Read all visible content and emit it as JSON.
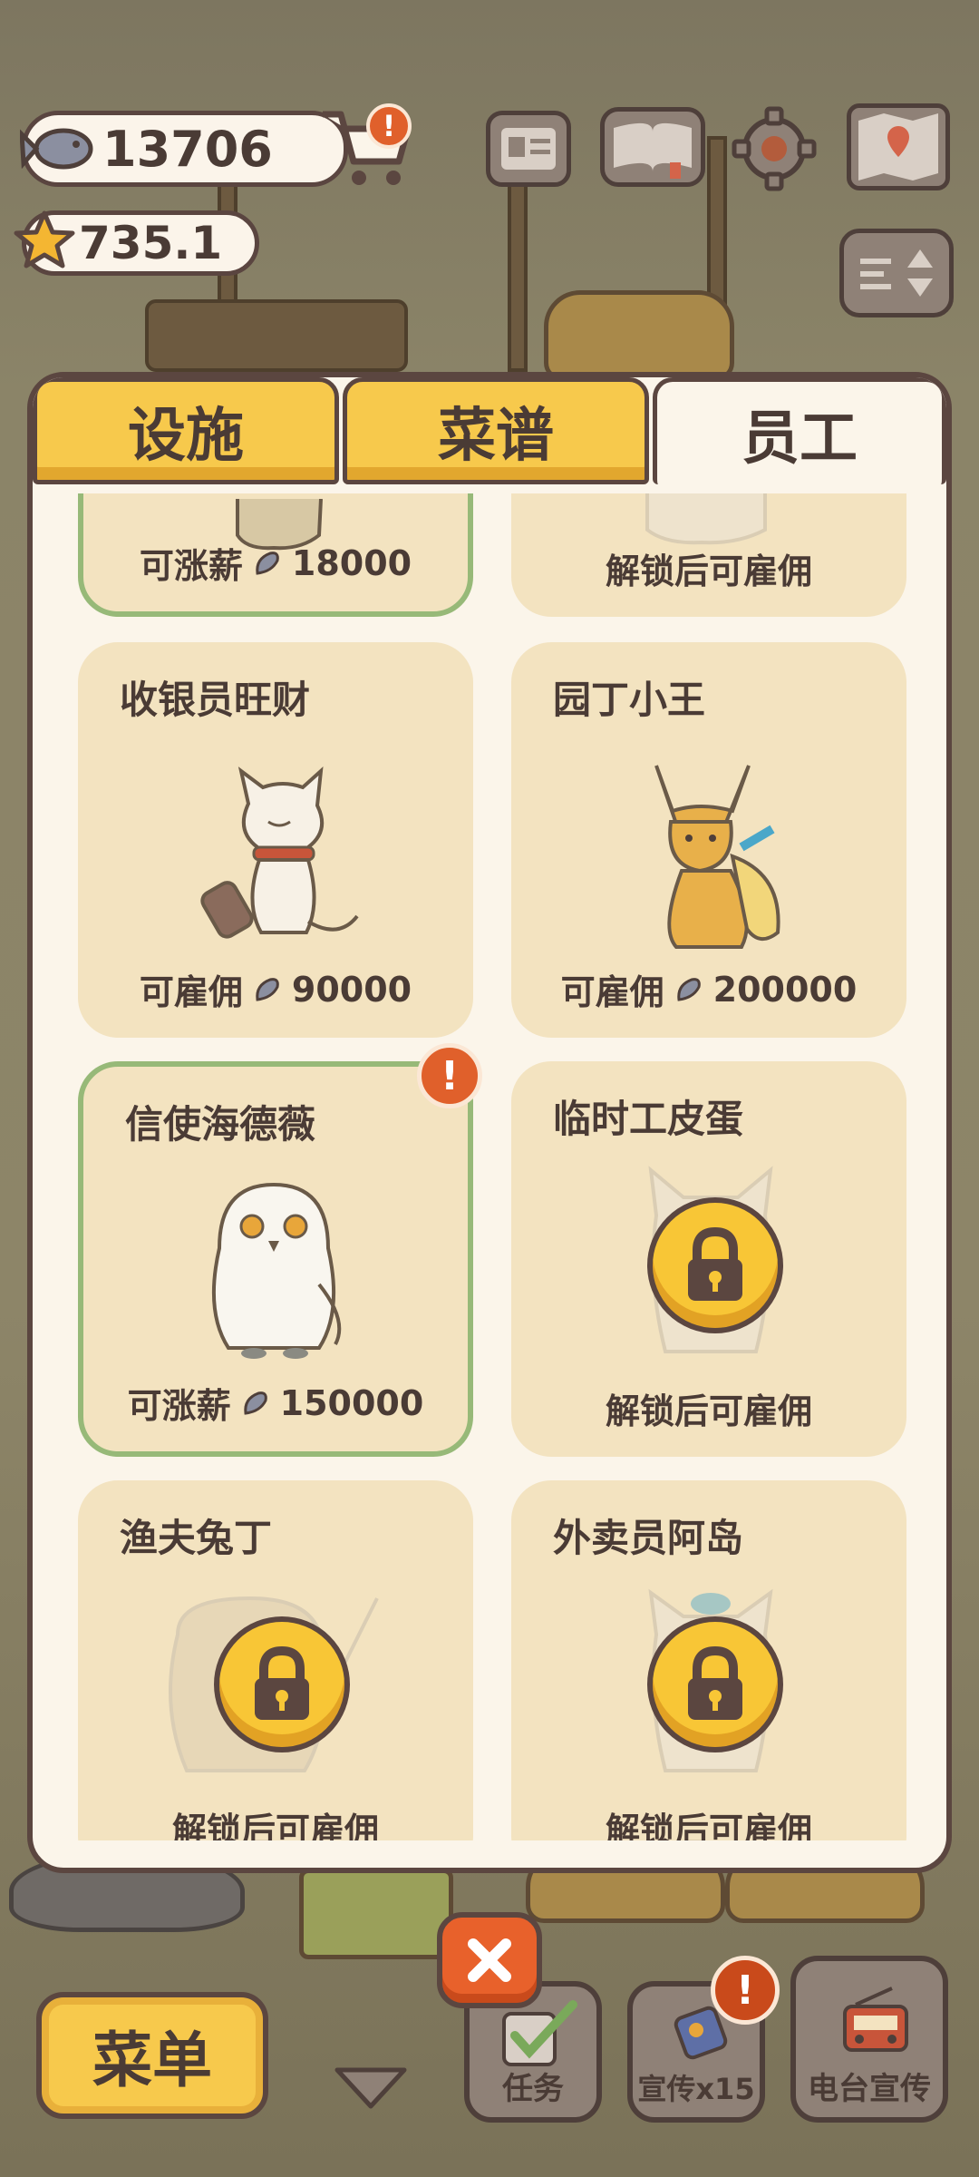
{
  "hud": {
    "fish_count": "13706",
    "star_count": "735.1"
  },
  "tabs": [
    {
      "label": "设施",
      "active": false
    },
    {
      "label": "菜谱",
      "active": false
    },
    {
      "label": "员工",
      "active": true
    }
  ],
  "staff": [
    {
      "name": "",
      "status": "可涨薪",
      "price": "18000",
      "locked": false
    },
    {
      "name": "",
      "status": "解锁后可雇佣",
      "price": "",
      "locked": true
    },
    {
      "name": "收银员旺财",
      "status": "可雇佣",
      "price": "90000",
      "locked": false
    },
    {
      "name": "园丁小王",
      "status": "可雇佣",
      "price": "200000",
      "locked": false
    },
    {
      "name": "信使海德薇",
      "status": "可涨薪",
      "price": "150000",
      "locked": false
    },
    {
      "name": "临时工皮蛋",
      "status": "解锁后可雇佣",
      "price": "",
      "locked": true
    },
    {
      "name": "渔夫兔丁",
      "status": "解锁后可雇佣",
      "price": "",
      "locked": true
    },
    {
      "name": "外卖员阿岛",
      "status": "解锁后可雇佣",
      "price": "",
      "locked": true
    }
  ],
  "bottom": {
    "menu_label": "菜单",
    "tasks_label": "任务",
    "promo_label": "宣传x15",
    "radio_label": "电台宣传"
  },
  "colors": {
    "panel_bg": "#fbf5ea",
    "card_bg": "#f3e3c0",
    "tab_yellow": "#f7c94c",
    "highlight_green": "#97b978",
    "badge_orange": "#e0602b",
    "outline_brown": "#5b4640"
  }
}
